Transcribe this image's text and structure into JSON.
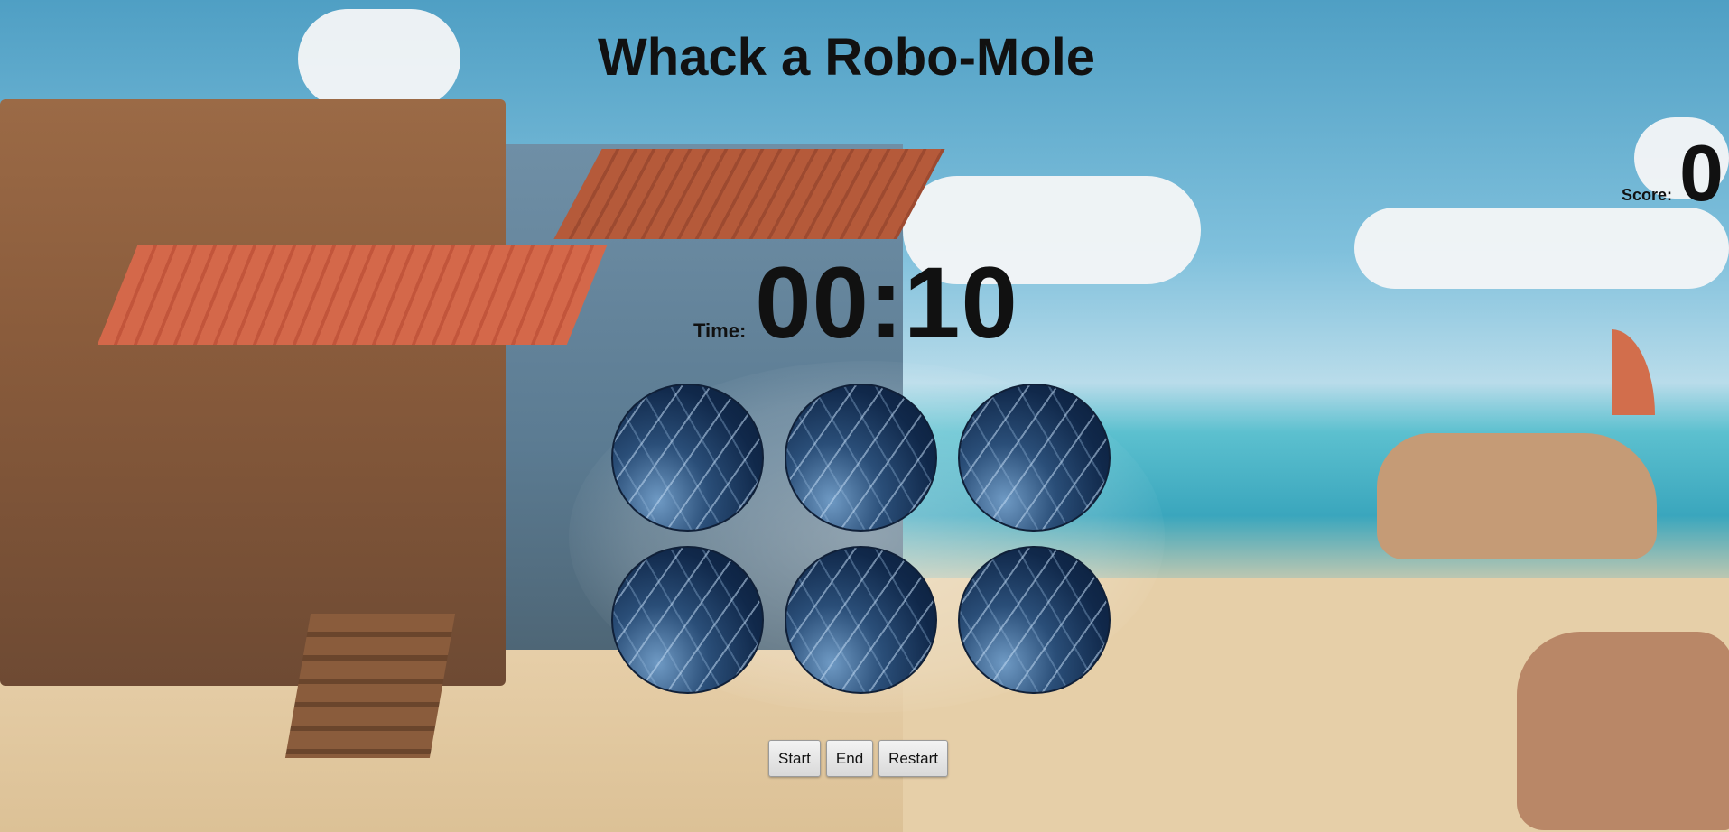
{
  "title": "Whack a Robo-Mole",
  "score": {
    "label": "Score:",
    "value": "0"
  },
  "timer": {
    "label": "Time:",
    "value": "00:10"
  },
  "holes": [
    {
      "id": "hole-1"
    },
    {
      "id": "hole-2"
    },
    {
      "id": "hole-3"
    },
    {
      "id": "hole-4"
    },
    {
      "id": "hole-5"
    },
    {
      "id": "hole-6"
    }
  ],
  "controls": {
    "start_label": "Start",
    "end_label": "End",
    "restart_label": "Restart"
  },
  "colors": {
    "text": "#111111",
    "hole_dark": "#0b1d38",
    "hole_light": "#6f9ac4"
  }
}
